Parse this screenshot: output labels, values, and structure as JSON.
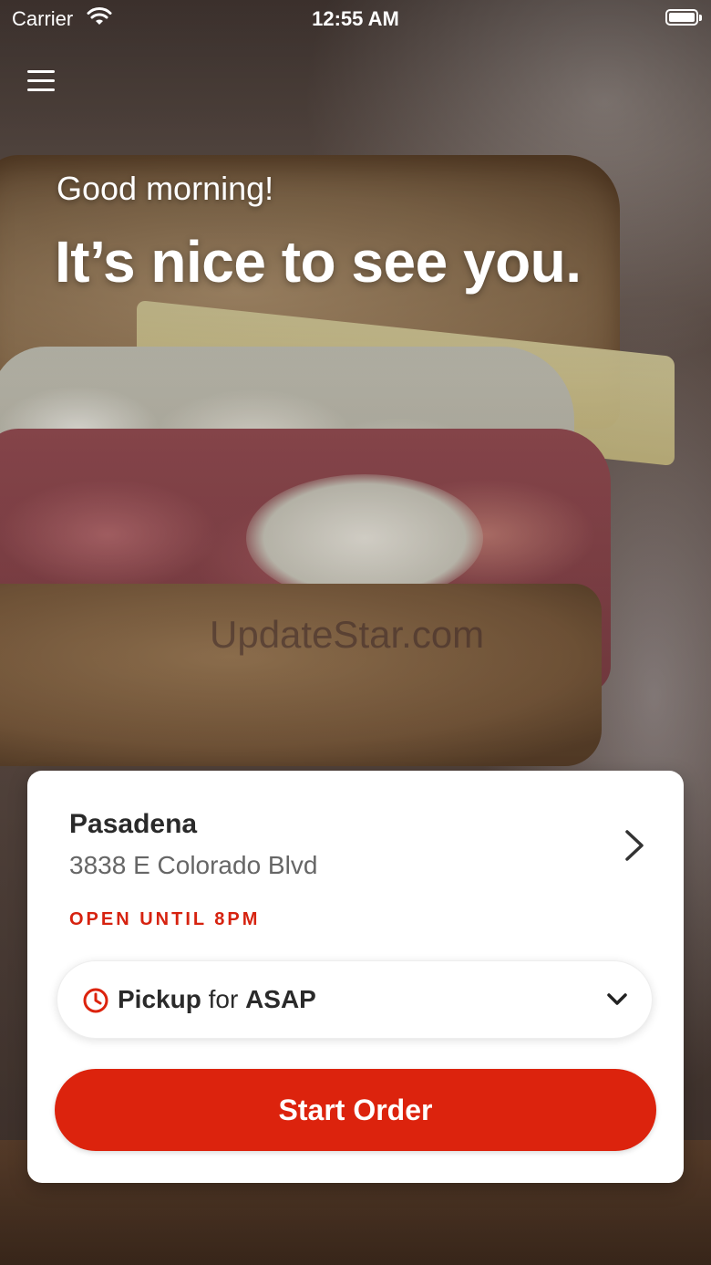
{
  "status_bar": {
    "carrier": "Carrier",
    "time": "12:55 AM",
    "wifi_icon": "wifi-icon",
    "battery_icon": "battery-icon"
  },
  "header": {
    "menu_icon": "hamburger-menu-icon"
  },
  "hero": {
    "greeting": "Good morning!",
    "headline": "It’s nice to see you.",
    "watermark": "UpdateStar.com"
  },
  "location_card": {
    "location_name": "Pasadena",
    "address": "3838 E Colorado Blvd",
    "hours": "OPEN UNTIL 8PM",
    "order_type": {
      "mode": "Pickup",
      "connector": "for",
      "time": "ASAP"
    },
    "start_order_label": "Start Order"
  },
  "colors": {
    "accent": "#dc230d",
    "hours_text": "#d6220f",
    "card_background": "#ffffff"
  }
}
